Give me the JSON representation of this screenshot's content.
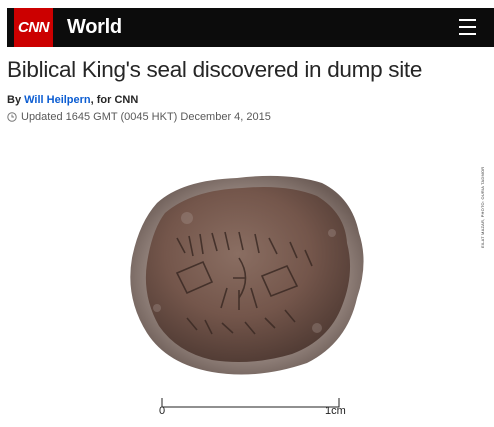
{
  "header": {
    "logo_text": "CNN",
    "section_title": "World",
    "menu_icon": "hamburger-menu-icon",
    "brand_color": "#cc0000"
  },
  "article": {
    "headline": "Biblical King's seal discovered in dump site",
    "byline_prefix": "By ",
    "author": "Will Heilpern",
    "byline_suffix": ", for CNN",
    "updated": "Updated 1645 GMT (0045 HKT) December 4, 2015"
  },
  "photo": {
    "credit": "EILAT MAZAR, PHOTO: OURIA TADMOR",
    "scale_start": "0",
    "scale_end": "1cm"
  }
}
